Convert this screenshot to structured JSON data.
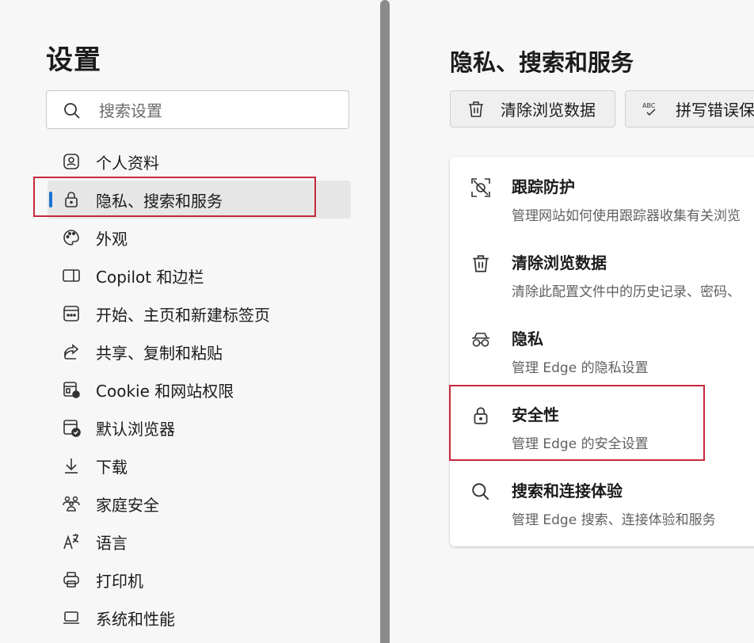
{
  "sidebar": {
    "title": "设置",
    "search": {
      "placeholder": "搜索设置",
      "value": ""
    },
    "items": [
      {
        "label": "个人资料",
        "icon": "profile-icon"
      },
      {
        "label": "隐私、搜索和服务",
        "icon": "lock-icon",
        "active": true
      },
      {
        "label": "外观",
        "icon": "palette-icon"
      },
      {
        "label": "Copilot 和边栏",
        "icon": "sidebar-icon"
      },
      {
        "label": "开始、主页和新建标签页",
        "icon": "home-tab-icon"
      },
      {
        "label": "共享、复制和粘贴",
        "icon": "share-icon"
      },
      {
        "label": "Cookie 和网站权限",
        "icon": "cookie-settings-icon"
      },
      {
        "label": "默认浏览器",
        "icon": "default-browser-icon"
      },
      {
        "label": "下载",
        "icon": "download-icon"
      },
      {
        "label": "家庭安全",
        "icon": "family-icon"
      },
      {
        "label": "语言",
        "icon": "language-icon"
      },
      {
        "label": "打印机",
        "icon": "printer-icon"
      },
      {
        "label": "系统和性能",
        "icon": "laptop-icon"
      }
    ]
  },
  "main": {
    "title": "隐私、搜索和服务",
    "quick_actions": [
      {
        "label": "清除浏览数据",
        "icon": "trash-icon"
      },
      {
        "label": "拼写错误保",
        "icon": "spellcheck-icon"
      }
    ],
    "sections": [
      {
        "title": "跟踪防护",
        "description": "管理网站如何使用跟踪器收集有关浏览",
        "icon": "tracking-prevention-icon"
      },
      {
        "title": "清除浏览数据",
        "description": "清除此配置文件中的历史记录、密码、",
        "icon": "trash-icon"
      },
      {
        "title": "隐私",
        "description": "管理 Edge 的隐私设置",
        "icon": "incognito-glasses-icon"
      },
      {
        "title": "安全性",
        "description": "管理 Edge 的安全设置",
        "icon": "lock-icon"
      },
      {
        "title": "搜索和连接体验",
        "description": "管理 Edge 搜索、连接体验和服务",
        "icon": "search-icon"
      }
    ]
  },
  "colors": {
    "accent": "#1a73d0",
    "highlight_border": "#c8283c",
    "background": "#f7f7f7"
  }
}
